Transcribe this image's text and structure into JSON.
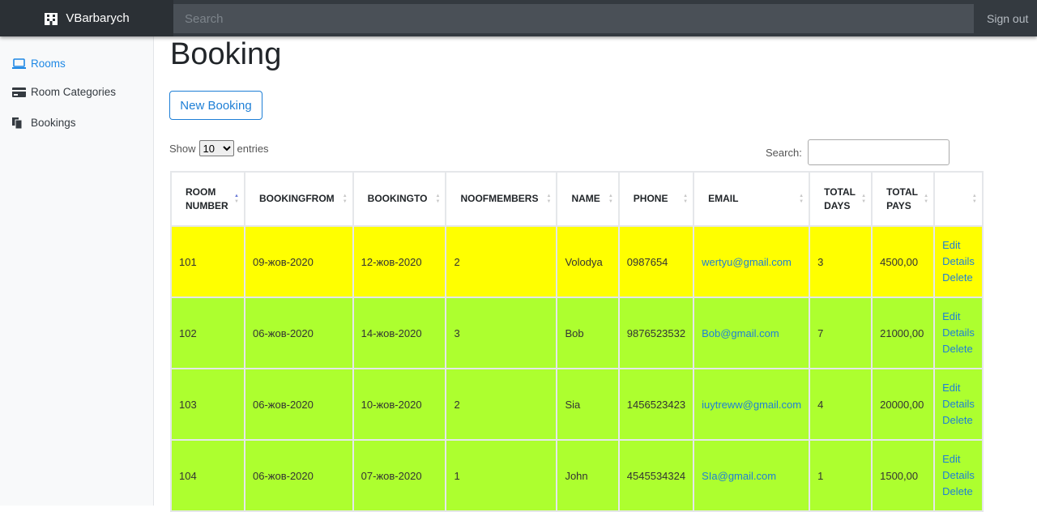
{
  "app": {
    "brand": "VBarbarych",
    "search_placeholder": "Search",
    "signout": "Sign out"
  },
  "sidebar": {
    "items": [
      {
        "label": "Rooms",
        "icon": "laptop-icon",
        "active": true
      },
      {
        "label": "Room Categories",
        "icon": "credit-card-icon",
        "active": false
      },
      {
        "label": "Bookings",
        "icon": "files-icon",
        "active": false
      }
    ]
  },
  "page": {
    "title": "Booking",
    "new_button": "New Booking",
    "show_label": "Show",
    "entries_label": "entries",
    "page_size": "10",
    "search_label": "Search:"
  },
  "colors": {
    "accent": "#1e88e5",
    "row_yellow": "#ffff00",
    "row_green": "#adff2f",
    "navbar": "#343a40"
  },
  "table": {
    "columns": [
      {
        "label": "ROOM NUMBER",
        "sorted": "asc"
      },
      {
        "label": "BOOKINGFROM"
      },
      {
        "label": "BOOKINGTO"
      },
      {
        "label": "NOOFMEMBERS"
      },
      {
        "label": "NAME"
      },
      {
        "label": "PHONE"
      },
      {
        "label": "EMAIL"
      },
      {
        "label": "TOTAL DAYS"
      },
      {
        "label": "TOTAL PAYS"
      },
      {
        "label": ""
      }
    ],
    "actions": {
      "edit": "Edit",
      "details": "Details",
      "delete": "Delete"
    },
    "rows": [
      {
        "room": "101",
        "from": "09-жов-2020",
        "to": "12-жов-2020",
        "members": "2",
        "name": "Volodya",
        "phone": "0987654",
        "email": "wertyu@gmail.com",
        "days": "3",
        "pays": "4500,00",
        "color": "#ffff00"
      },
      {
        "room": "102",
        "from": "06-жов-2020",
        "to": "14-жов-2020",
        "members": "3",
        "name": "Bob",
        "phone": "9876523532",
        "email": "Bob@gmail.com",
        "days": "7",
        "pays": "21000,00",
        "color": "#adff2f"
      },
      {
        "room": "103",
        "from": "06-жов-2020",
        "to": "10-жов-2020",
        "members": "2",
        "name": "Sia",
        "phone": "1456523423",
        "email": "iuytreww@gmail.com",
        "days": "4",
        "pays": "20000,00",
        "color": "#adff2f"
      },
      {
        "room": "104",
        "from": "06-жов-2020",
        "to": "07-жов-2020",
        "members": "1",
        "name": "John",
        "phone": "4545534324",
        "email": "SIa@gmail.com",
        "days": "1",
        "pays": "1500,00",
        "color": "#adff2f"
      }
    ]
  }
}
